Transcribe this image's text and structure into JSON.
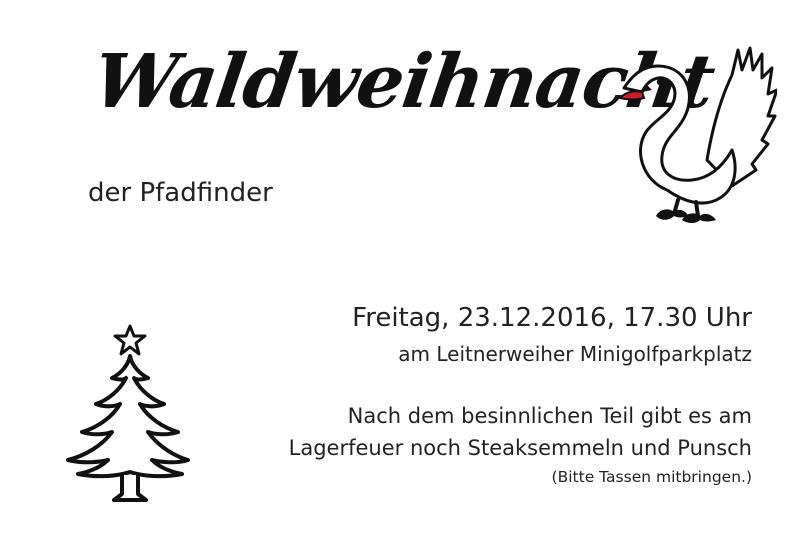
{
  "card": {
    "title": "Waldweihnacht",
    "subtitle": "der Pfadfinder",
    "date_time": "Freitag, 23.12.2016, 17.30 Uhr",
    "location": "am Leitnerweiher Minigolfparkplatz",
    "info_line_1": "Nach dem besinnlichen Teil gibt es am",
    "info_line_2": "Lagerfeuer noch Steaksemmeln und Punsch",
    "note": "(Bitte Tassen mitbringen.)"
  },
  "icons": {
    "swan": "swan-icon",
    "tree": "christmas-tree-icon"
  },
  "colors": {
    "swan_beak": "#c8202a",
    "ink": "#111111",
    "background": "#ffffff"
  }
}
